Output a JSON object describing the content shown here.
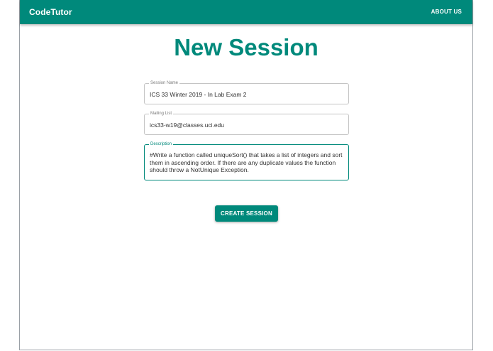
{
  "appbar": {
    "brand": "CodeTutor",
    "nav_about": "ABOUT US"
  },
  "page": {
    "title": "New Session"
  },
  "form": {
    "session_name": {
      "label": "Session Name",
      "value": "ICS 33 Winter 2019 - In Lab Exam 2"
    },
    "mailing_list": {
      "label": "Mailing List",
      "value": "ics33-w19@classes.uci.edu"
    },
    "description": {
      "label": "Description",
      "value": "#Write a function called uniqueSort() that takes a list of integers and sort them in ascending order. If there are any duplicate values the function should throw a NotUnique Exception."
    },
    "submit_label": "CREATE SESSION"
  },
  "colors": {
    "primary": "#00897b",
    "background": "#ffffff"
  }
}
